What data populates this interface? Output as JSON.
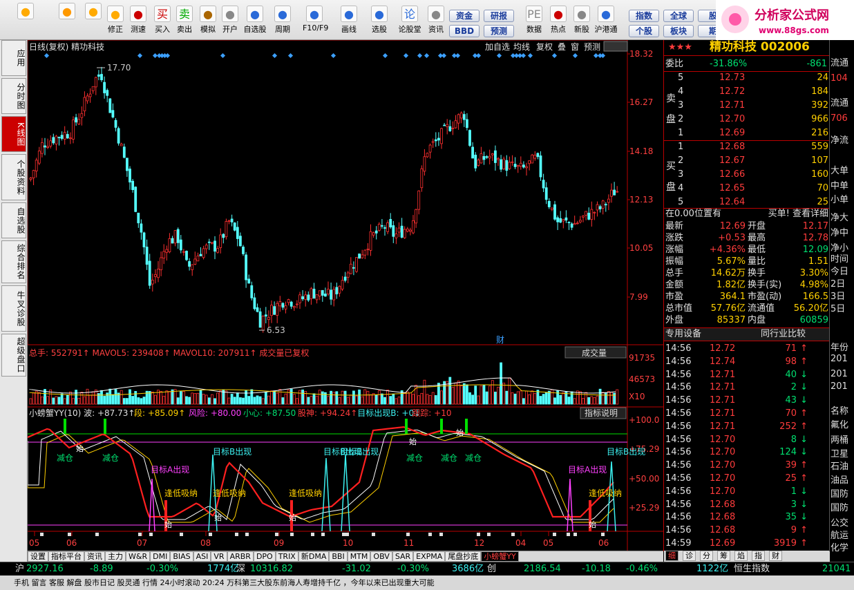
{
  "toolbar": {
    "buttons": [
      {
        "label": "",
        "icon": "grid-icon"
      },
      {
        "label": "",
        "icon": "back-arrow-icon"
      },
      {
        "label": "",
        "icon": "up-down-arrows-icon"
      },
      {
        "label": "修正",
        "icon": "smile-icon"
      },
      {
        "label": "测速",
        "icon": "clock-icon"
      },
      {
        "label": "买入",
        "icon": "buy-icon",
        "glyph": "买"
      },
      {
        "label": "卖出",
        "icon": "sell-icon",
        "glyph": "卖"
      },
      {
        "label": "模拟",
        "icon": "hammer-icon"
      },
      {
        "label": "开户",
        "icon": "lock-icon"
      },
      {
        "label": "自选股",
        "icon": "star-icon"
      },
      {
        "label": "周期",
        "icon": "cycle-icon"
      },
      {
        "label": "F10/F9",
        "icon": "f10-icon"
      },
      {
        "label": "画线",
        "icon": "pen-icon"
      },
      {
        "label": "选股",
        "icon": "screen-icon"
      },
      {
        "label": "论股堂",
        "icon": "discuss-icon",
        "glyph": "论"
      },
      {
        "label": "资讯",
        "icon": "news-icon"
      },
      {
        "label": "数据",
        "icon": "pe-icon",
        "glyph": "PE"
      },
      {
        "label": "热点",
        "icon": "hot-icon"
      },
      {
        "label": "新股",
        "icon": "new-stock-icon"
      },
      {
        "label": "沪港通",
        "icon": "sse-hk-icon"
      }
    ],
    "small_buttons": [
      "资金",
      "BBD",
      "研报",
      "预测",
      "指数",
      "个股",
      "全球",
      "板块",
      "股",
      "期"
    ],
    "logo_text": "分析家公式网",
    "logo_url": "www.88gs.com"
  },
  "left_tabs": [
    "应用",
    "分时图",
    "K线图",
    "个股资料",
    "自选股",
    "综合排名",
    "牛叉诊股",
    "超级盘口"
  ],
  "chart_header": {
    "left": "日线(复权) 精功科技",
    "right_buttons": [
      "加自选",
      "均线",
      "复权",
      "叠",
      "窗",
      "预测"
    ]
  },
  "price_axis": [
    "18.32",
    "16.27",
    "14.18",
    "12.13",
    "10.05",
    "7.99"
  ],
  "annotations": {
    "high": "17.70",
    "low": "6.53",
    "cai": "财"
  },
  "volume": {
    "header": "总手: 552791↑  MAVOL5: 239408↑  MAVOL10: 207911↑  成交量已复权",
    "menu": "成交量",
    "axis": [
      "91735",
      "46573",
      "X10"
    ]
  },
  "indicator": {
    "title": "小螃蟹YY(10) 波: +87.73↑  段: +85.09↑  风险: +80.00  小心: +87.50  股神: +94.24↑  目标出现B: +0↓  跟踪: +10",
    "parts": [
      {
        "t": "小螃蟹YY(10) 波: +87.73↑",
        "c": "#e0e0e0"
      },
      {
        "t": "段: +85.09↑",
        "c": "#ffd000"
      },
      {
        "t": "风险: +80.00",
        "c": "#ff40ff"
      },
      {
        "t": "小心: +87.50",
        "c": "#00e070"
      },
      {
        "t": "股神: +94.24↑",
        "c": "#ff3c3c"
      },
      {
        "t": "目标出现B: +0↓",
        "c": "#3cf0f0"
      },
      {
        "t": "跟踪: +10",
        "c": "#ff3c3c"
      }
    ],
    "button": "指标说明",
    "axis": [
      "+100.0",
      "+75.29",
      "+50.00",
      "+25.29"
    ],
    "labels": {
      "jiancang": "减仓",
      "mubiaoA": "目标A出现",
      "mubiaoB": "目标B出现",
      "fengdi": "逢低吸纳",
      "shi": "始"
    }
  },
  "x_axis": [
    "05",
    "06",
    "07",
    "08",
    "09",
    "10",
    "11",
    "12",
    "04",
    "05",
    "06"
  ],
  "bottom_tabs": [
    "设置",
    "指标平台",
    "资讯",
    "主力",
    "W&R",
    "DMI",
    "BIAS",
    "ASI",
    "VR",
    "ARBR",
    "DPO",
    "TRIX",
    "新DMA",
    "BBI",
    "MTM",
    "OBV",
    "SAR",
    "EXPMA",
    "尾盘抄底",
    "小螃蟹YY"
  ],
  "quote": {
    "stars": "★★★",
    "name": "精功科技 002006",
    "weibi": {
      "label": "委比",
      "pct": "-31.86%",
      "val": "-861"
    },
    "sell": [
      [
        "5",
        "12.73",
        "24"
      ],
      [
        "4",
        "12.72",
        "184"
      ],
      [
        "3",
        "12.71",
        "392"
      ],
      [
        "2",
        "12.70",
        "966"
      ],
      [
        "1",
        "12.69",
        "216"
      ]
    ],
    "buy": [
      [
        "1",
        "12.68",
        "559"
      ],
      [
        "2",
        "12.67",
        "107"
      ],
      [
        "3",
        "12.66",
        "160"
      ],
      [
        "4",
        "12.65",
        "70"
      ],
      [
        "5",
        "12.64",
        "25"
      ]
    ],
    "sell_side": "卖盘",
    "buy_side": "买盘",
    "info_left": "在0.00位置有",
    "info_right": "买单! 查看详细",
    "stats": [
      [
        "最新",
        "12.69",
        "开盘",
        "12.17"
      ],
      [
        "涨跌",
        "+0.53",
        "最高",
        "12.78"
      ],
      [
        "涨幅",
        "+4.36%",
        "最低",
        "12.09"
      ],
      [
        "振幅",
        "5.67%",
        "量比",
        "1.51"
      ],
      [
        "总手",
        "14.62万",
        "换手",
        "3.30%"
      ],
      [
        "金额",
        "1.82亿",
        "换手(实)",
        "4.98%"
      ],
      [
        "市盈",
        "364.1",
        "市盈(动)",
        "166.5"
      ],
      [
        "总市值",
        "57.76亿",
        "流通值",
        "56.20亿"
      ],
      [
        "外盘",
        "85337",
        "内盘",
        "60859"
      ]
    ],
    "tools_left": "专用设备",
    "tools_right": "同行业比较",
    "ticks": [
      [
        "14:56",
        "12.72",
        "71",
        "up"
      ],
      [
        "14:56",
        "12.74",
        "98",
        "up"
      ],
      [
        "14:56",
        "12.71",
        "40",
        "down"
      ],
      [
        "14:56",
        "12.71",
        "2",
        "down"
      ],
      [
        "14:56",
        "12.71",
        "43",
        "down"
      ],
      [
        "14:56",
        "12.71",
        "70",
        "up"
      ],
      [
        "14:56",
        "12.71",
        "252",
        "up"
      ],
      [
        "14:56",
        "12.70",
        "8",
        "down"
      ],
      [
        "14:56",
        "12.70",
        "124",
        "down"
      ],
      [
        "14:56",
        "12.70",
        "39",
        "up"
      ],
      [
        "14:56",
        "12.70",
        "25",
        "up"
      ],
      [
        "14:56",
        "12.70",
        "1",
        "down"
      ],
      [
        "14:56",
        "12.68",
        "3",
        "down"
      ],
      [
        "14:56",
        "12.68",
        "35",
        "down"
      ],
      [
        "14:56",
        "12.68",
        "9",
        "up"
      ],
      [
        "14:59",
        "12.69",
        "3919",
        "up"
      ]
    ],
    "bottom_tabs": [
      "细",
      "诊",
      "分",
      "筹",
      "焰",
      "指",
      "财"
    ]
  },
  "right_extra": [
    "流通",
    "104",
    "流通",
    "706",
    "净流",
    "大单",
    "中单",
    "小单",
    "净大",
    "净中",
    "净小",
    "时间",
    "今日",
    "2日",
    "3日",
    "5日",
    "年份",
    "201",
    "201",
    "201",
    "名称",
    "氟化",
    "两桶",
    "卫星",
    "石油",
    "油品",
    "国防",
    "国防",
    "公交",
    "航运",
    "化学"
  ],
  "status": {
    "sh": "沪",
    "sh_idx": "2927.16",
    "sh_chg": "-8.89",
    "sh_pct": "-0.30%",
    "sh_amt": "1774亿",
    "sz": "深",
    "sz_idx": "10316.82",
    "sz_chg": "-31.02",
    "sz_pct": "-0.30%",
    "sz_amt": "3686亿",
    "cy": "创",
    "cy_idx": "2186.54",
    "cy_chg": "-10.18",
    "cy_pct": "-0.46%",
    "cy_amt": "1122亿",
    "hs": "恒生指数",
    "hs_idx": "21041"
  },
  "news": "手机  留言  客服  解盘  股市日记  股灵通  行情  24小时滚动      20:24 万科第三大股东前海人寿增持千亿 ，今年以来已出现重大可能"
}
